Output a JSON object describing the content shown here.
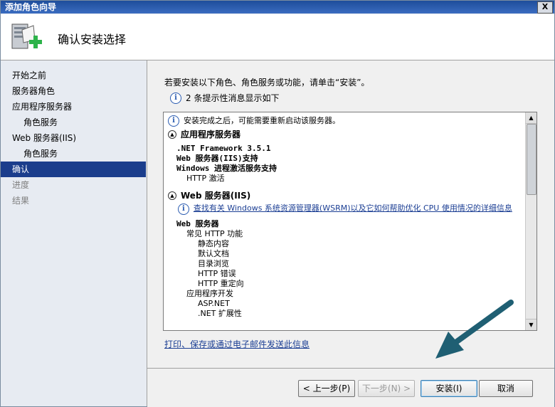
{
  "window": {
    "title": "添加角色向导",
    "close_label": "X"
  },
  "header": {
    "title": "确认安装选择",
    "icon": "server-add-icon"
  },
  "sidebar": {
    "items": [
      {
        "label": "开始之前",
        "state": "normal",
        "level": 0
      },
      {
        "label": "服务器角色",
        "state": "normal",
        "level": 0
      },
      {
        "label": "应用程序服务器",
        "state": "normal",
        "level": 0
      },
      {
        "label": "角色服务",
        "state": "normal",
        "level": 1
      },
      {
        "label": "Web 服务器(IIS)",
        "state": "normal",
        "level": 0
      },
      {
        "label": "角色服务",
        "state": "normal",
        "level": 1
      },
      {
        "label": "确认",
        "state": "active",
        "level": 0
      },
      {
        "label": "进度",
        "state": "disabled",
        "level": 0
      },
      {
        "label": "结果",
        "state": "disabled",
        "level": 0
      }
    ]
  },
  "main": {
    "intro": "若要安装以下角色、角色服务或功能，请单击“安装”。",
    "info_summary": "2 条提示性消息显示如下",
    "restart_note": "安装完成之后，可能需要重新启动该服务器。",
    "app_server": {
      "heading": "应用程序服务器",
      "lines": [
        ".NET Framework 3.5.1",
        "Web 服务器(IIS)支持",
        "Windows 进程激活服务支持"
      ],
      "sub": "HTTP 激活"
    },
    "iis": {
      "heading": "Web 服务器(IIS)",
      "link": "查找有关 Windows 系统资源管理器(WSRM)以及它如何帮助优化 CPU 使用情况的详细信息",
      "group": "Web 服务器",
      "common_http": "常见 HTTP 功能",
      "common_items": [
        "静态内容",
        "默认文档",
        "目录浏览",
        "HTTP 错误",
        "HTTP 重定向"
      ],
      "app_dev": "应用程序开发",
      "app_items": [
        "ASP.NET",
        ".NET 扩展性"
      ]
    },
    "footer_link": "打印、保存或通过电子邮件发送此信息"
  },
  "buttons": {
    "prev": "< 上一步(P)",
    "next": "下一步(N) >",
    "install": "安装(I)",
    "cancel": "取消"
  },
  "colors": {
    "accent": "#1b3d8c",
    "arrow": "#1f5f73",
    "link": "#1c3f94"
  }
}
